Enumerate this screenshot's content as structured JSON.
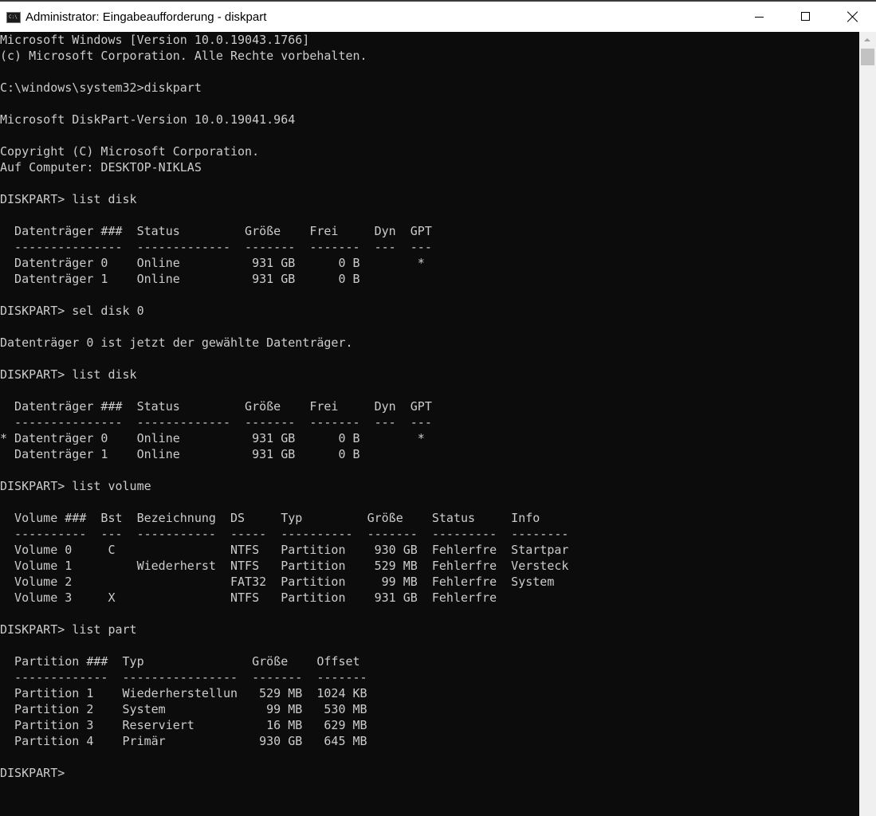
{
  "window": {
    "title": "Administrator: Eingabeaufforderung - diskpart",
    "icon": "cmd-icon",
    "icon_text": "C:\\"
  },
  "controls": {
    "minimize": "minimize-icon",
    "maximize": "maximize-icon",
    "close": "close-icon"
  },
  "console": {
    "colors": {
      "background": "#0c0c0c",
      "text": "#cccccc"
    },
    "lines": [
      "Microsoft Windows [Version 10.0.19043.1766]",
      "(c) Microsoft Corporation. Alle Rechte vorbehalten.",
      "",
      "C:\\windows\\system32>diskpart",
      "",
      "Microsoft DiskPart-Version 10.0.19041.964",
      "",
      "Copyright (C) Microsoft Corporation.",
      "Auf Computer: DESKTOP-NIKLAS",
      "",
      "DISKPART> list disk",
      "",
      "  Datenträger ###  Status         Größe    Frei     Dyn  GPT",
      "  ---------------  -------------  -------  -------  ---  ---",
      "  Datenträger 0    Online          931 GB      0 B        *",
      "  Datenträger 1    Online          931 GB      0 B",
      "",
      "DISKPART> sel disk 0",
      "",
      "Datenträger 0 ist jetzt der gewählte Datenträger.",
      "",
      "DISKPART> list disk",
      "",
      "  Datenträger ###  Status         Größe    Frei     Dyn  GPT",
      "  ---------------  -------------  -------  -------  ---  ---",
      "* Datenträger 0    Online          931 GB      0 B        *",
      "  Datenträger 1    Online          931 GB      0 B",
      "",
      "DISKPART> list volume",
      "",
      "  Volume ###  Bst  Bezeichnung  DS     Typ         Größe    Status     Info",
      "  ----------  ---  -----------  -----  ----------  -------  ---------  --------",
      "  Volume 0     C                NTFS   Partition    930 GB  Fehlerfre  Startpar",
      "  Volume 1         Wiederherst  NTFS   Partition    529 MB  Fehlerfre  Versteck",
      "  Volume 2                      FAT32  Partition     99 MB  Fehlerfre  System",
      "  Volume 3     X                NTFS   Partition    931 GB  Fehlerfre",
      "",
      "DISKPART> list part",
      "",
      "  Partition ###  Typ               Größe    Offset",
      "  -------------  ----------------  -------  -------",
      "  Partition 1    Wiederherstellun   529 MB  1024 KB",
      "  Partition 2    System              99 MB   530 MB",
      "  Partition 3    Reserviert          16 MB   629 MB",
      "  Partition 4    Primär             930 GB   645 MB",
      "",
      "DISKPART>"
    ]
  }
}
